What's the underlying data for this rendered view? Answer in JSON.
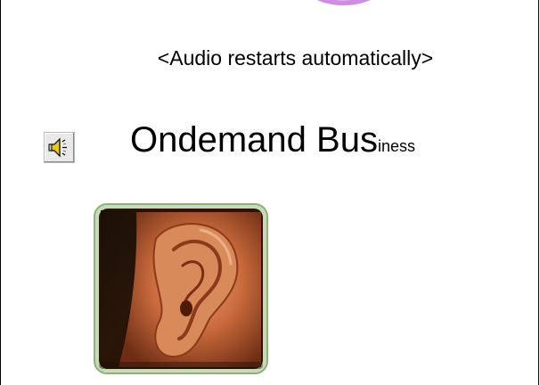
{
  "slide": {
    "instruction_text": "<Audio restarts automatically>",
    "headline": {
      "part1": "Ondemand Bus",
      "part2": "iness"
    },
    "speaker_icon": "speaker-icon",
    "image_icon": "ear-photo"
  },
  "colors": {
    "decoration": "#c97fe0",
    "tile_border": "#a7c694"
  }
}
